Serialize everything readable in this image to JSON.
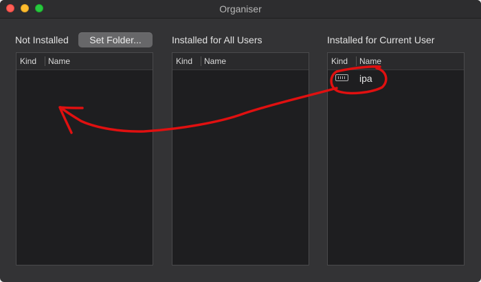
{
  "window": {
    "title": "Organiser"
  },
  "panels": {
    "not_installed": {
      "label": "Not Installed",
      "set_folder_label": "Set Folder...",
      "columns": {
        "kind": "Kind",
        "name": "Name"
      }
    },
    "all_users": {
      "label": "Installed for All Users",
      "columns": {
        "kind": "Kind",
        "name": "Name"
      }
    },
    "current_user": {
      "label": "Installed for Current User",
      "columns": {
        "kind": "Kind",
        "name": "Name"
      },
      "rows": [
        {
          "kind_icon": "keyboard-icon",
          "name": "ipa"
        }
      ]
    }
  },
  "colors": {
    "annotation": "#e01010",
    "window_bg": "#333335",
    "table_bg": "#1e1e20"
  }
}
